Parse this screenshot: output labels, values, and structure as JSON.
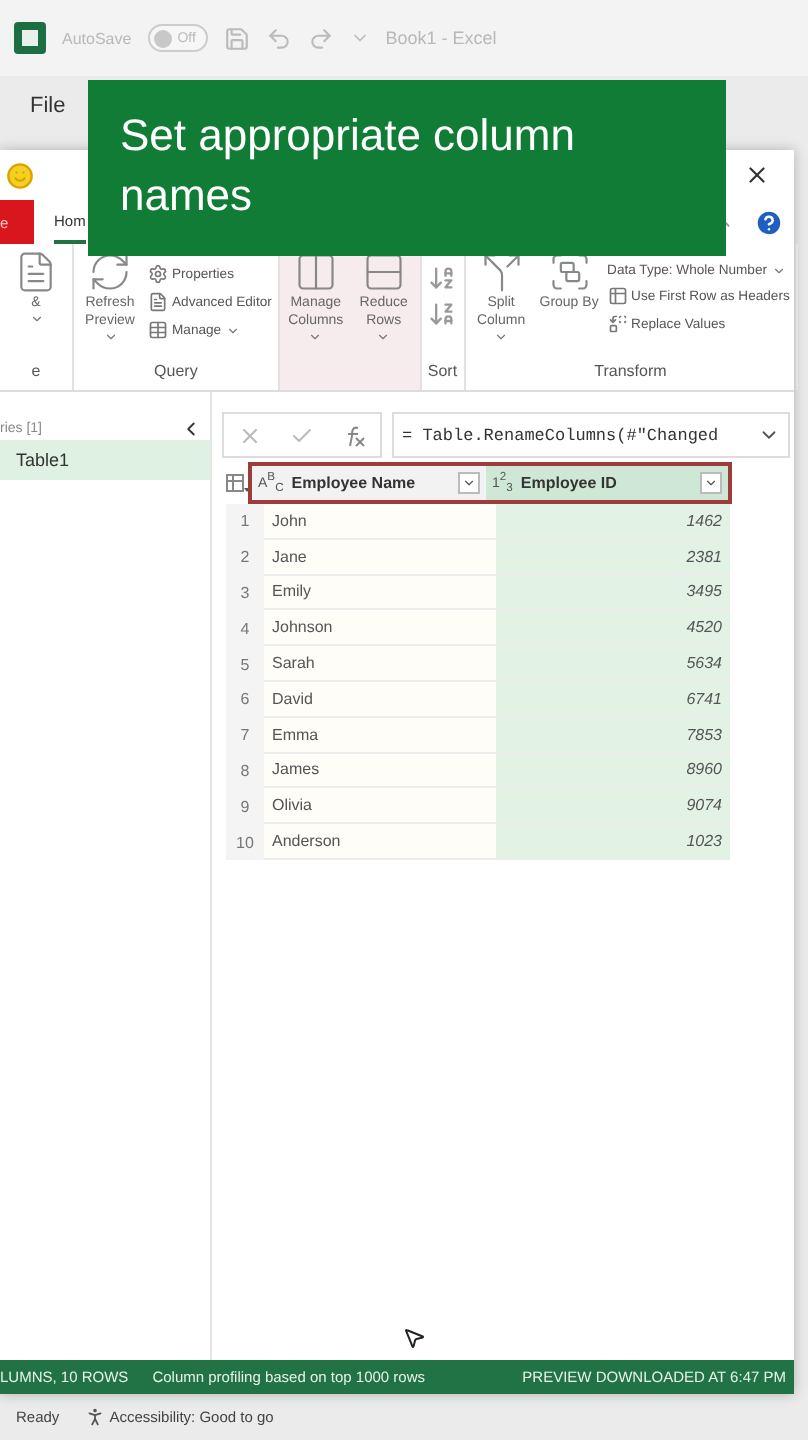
{
  "excel_title_bar": {
    "autosave_label": "AutoSave",
    "autosave_toggle": {
      "label": "Off",
      "on": false
    },
    "title": "Book1  -  Excel"
  },
  "menu": [
    "File"
  ],
  "banner": {
    "text": "Set appropriate column names"
  },
  "editor": {
    "tabs": [
      {
        "label": "e",
        "kind": "file",
        "selected": false
      },
      {
        "label": "Hom",
        "kind": "tab",
        "selected": true
      }
    ],
    "ribbon_groups": [
      {
        "label": "e",
        "highlighted": false,
        "items": [
          {
            "kind": "large",
            "label": "&",
            "dropdown": true
          }
        ]
      },
      {
        "label": "Query",
        "highlighted": false,
        "items": [
          {
            "kind": "large",
            "label": "Refresh Preview",
            "dropdown": true
          },
          {
            "kind": "small",
            "label": "Properties",
            "dropdown": false
          },
          {
            "kind": "small",
            "label": "Advanced Editor",
            "dropdown": false
          },
          {
            "kind": "small",
            "label": "Manage",
            "dropdown": true
          }
        ]
      },
      {
        "highlighted": true,
        "items": [
          {
            "kind": "large",
            "label": "Manage Columns",
            "dropdown": true
          },
          {
            "kind": "large",
            "label": "Reduce Rows",
            "dropdown": true
          }
        ]
      },
      {
        "label": "Sort",
        "highlighted": false,
        "items": [
          {
            "kind": "sort"
          }
        ]
      },
      {
        "label": "Transform",
        "highlighted": false,
        "items": [
          {
            "kind": "large",
            "label": "Split Column",
            "dropdown": true
          },
          {
            "kind": "large",
            "label": "Group By",
            "dropdown": false
          },
          {
            "kind": "small",
            "label": "Data Type: Whole Number",
            "dropdown": true
          },
          {
            "kind": "small",
            "label": "Use First Row as Headers",
            "dropdown": false
          },
          {
            "kind": "small",
            "label": "Replace Values",
            "dropdown": false
          }
        ]
      }
    ],
    "queries": {
      "title": "ries [1]",
      "items": [
        {
          "label": "Table1",
          "selected": true
        }
      ]
    },
    "formula": "= Table.RenameColumns(#\"Changed",
    "columns": [
      {
        "type": "A$^{B}$$_{C}$",
        "name": "Employee Name",
        "selected": false
      },
      {
        "type": "1$^{2}$$_{3}$",
        "name": "Employee ID",
        "selected": true
      }
    ],
    "rows": [
      {
        "n": "1",
        "name": "John",
        "id": "1462"
      },
      {
        "n": "2",
        "name": "Jane",
        "id": "2381"
      },
      {
        "n": "3",
        "name": "Emily",
        "id": "3495"
      },
      {
        "n": "4",
        "name": "Johnson",
        "id": "4520"
      },
      {
        "n": "5",
        "name": "Sarah",
        "id": "5634"
      },
      {
        "n": "6",
        "name": "David",
        "id": "6741"
      },
      {
        "n": "7",
        "name": "Emma",
        "id": "7853"
      },
      {
        "n": "8",
        "name": "James",
        "id": "8960"
      },
      {
        "n": "9",
        "name": "Olivia",
        "id": "9074"
      },
      {
        "n": "10",
        "name": "Anderson",
        "id": "1023"
      }
    ],
    "status_bar": {
      "left": "LUMNS, 10 ROWS",
      "middle": "Column profiling based on top 1000 rows",
      "right": "PREVIEW DOWNLOADED AT 6:47 PM"
    }
  },
  "excel_status_bar": {
    "ready": "Ready",
    "accessibility": "Accessibility: Good to go"
  }
}
